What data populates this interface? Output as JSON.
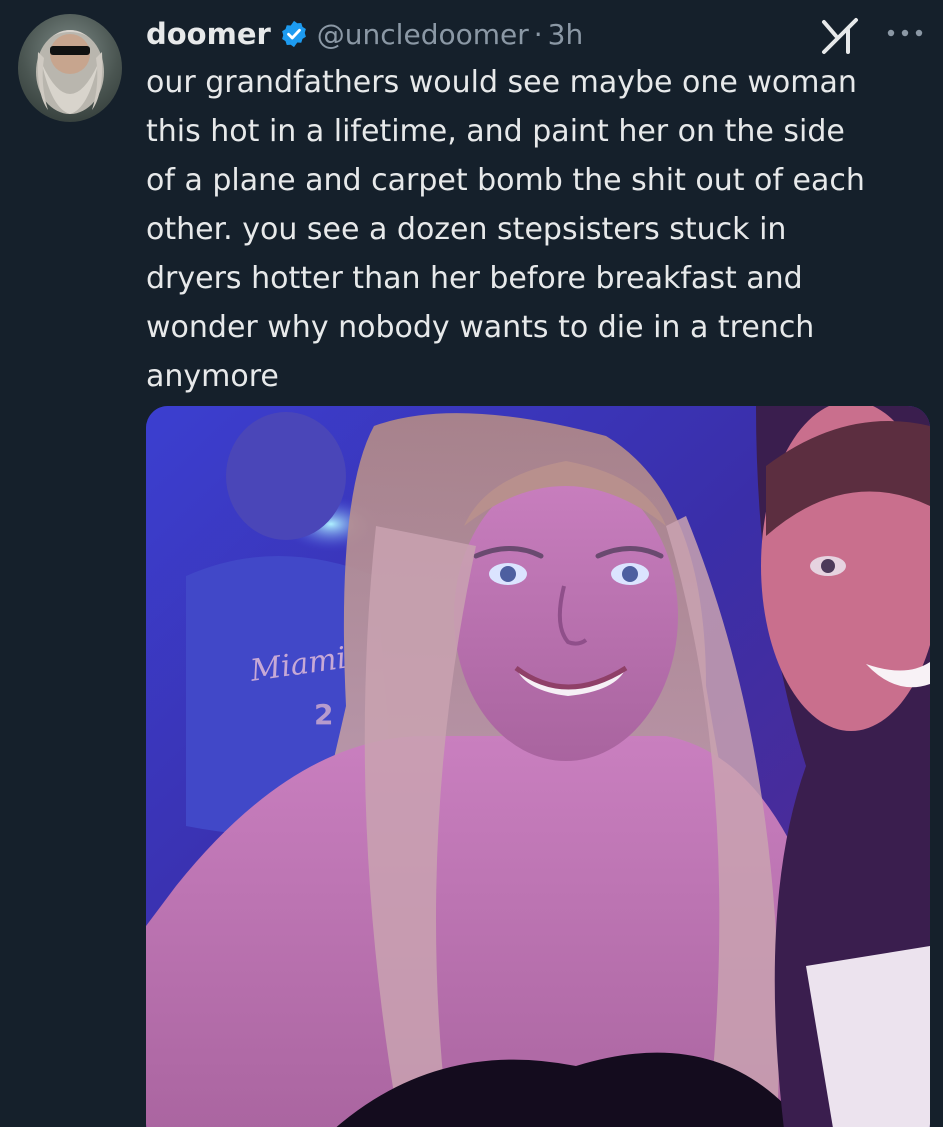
{
  "tweet": {
    "author_name": "doomer",
    "handle": "@uncledoomer",
    "separator": "·",
    "time": "3h",
    "text": "our grandfathers would see maybe one woman\nthis hot in a lifetime, and paint her on the side\nof a plane and carpet bomb the shit out of each\nother. you see a dozen stepsisters stuck in\ndryers hotter than her before breakfast and\nwonder why nobody wants to die in a trench\nanymore",
    "media": {
      "jersey_text": "Miami",
      "jersey_number": "2"
    }
  },
  "icons": {
    "verified": "verified-badge-icon",
    "grok": "grok-icon",
    "more": "more-options-icon"
  },
  "colors": {
    "background": "#15202b",
    "text_primary": "#e7e9ea",
    "text_secondary": "#8b98a5",
    "verified_blue": "#1d9bf0"
  }
}
